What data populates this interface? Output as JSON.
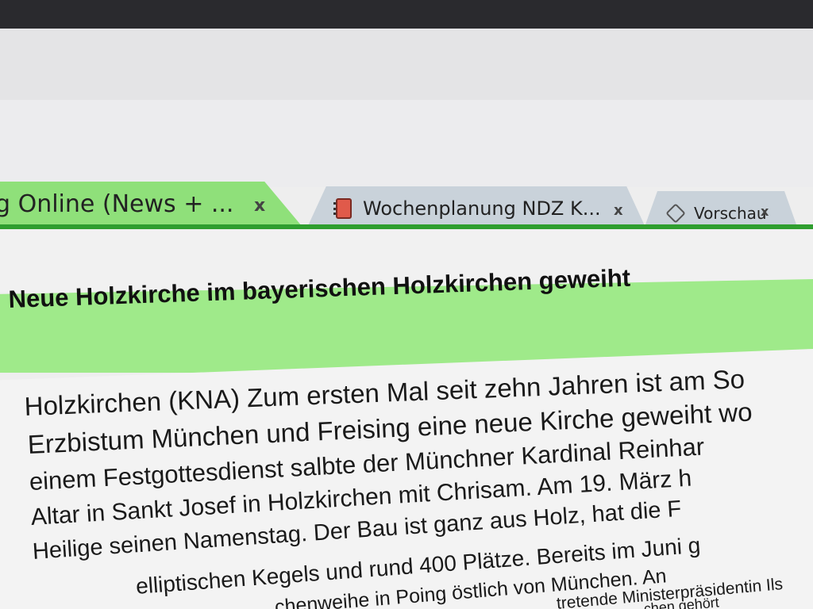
{
  "tabs": [
    {
      "label": "g Online (News + ...",
      "close": "x",
      "icon": "none",
      "active": true
    },
    {
      "label": "Wochenplanung NDZ K...",
      "close": "x",
      "icon": "notebook-icon",
      "active": false
    },
    {
      "label": "Vorschau",
      "close": "x",
      "icon": "preview-icon",
      "active": false
    }
  ],
  "colors": {
    "active_tab": "#8fe07a",
    "tab_underline": "#2f9e2f",
    "headline_band": "#9fea8a",
    "inactive_tab": "#c9d2da"
  },
  "article": {
    "headline": "Neue Holzkirche im bayerischen Holzkirchen geweiht",
    "lines": [
      "Holzkirchen (KNA) Zum ersten Mal seit zehn Jahren ist am So",
      "Erzbistum München und Freising eine neue Kirche geweiht wo",
      "einem Festgottesdienst salbte der Münchner Kardinal Reinhar",
      "Altar in Sankt Josef in Holzkirchen mit Chrisam. Am 19. März h",
      "Heilige seinen Namenstag. Der Bau ist ganz aus Holz, hat die F",
      "elliptischen Kegels und rund 400 Plätze. Bereits im Juni g",
      "chenweihe in Poing östlich von München. An",
      "tretende Ministerpräsidentin Ils",
      "chen gehört"
    ]
  }
}
